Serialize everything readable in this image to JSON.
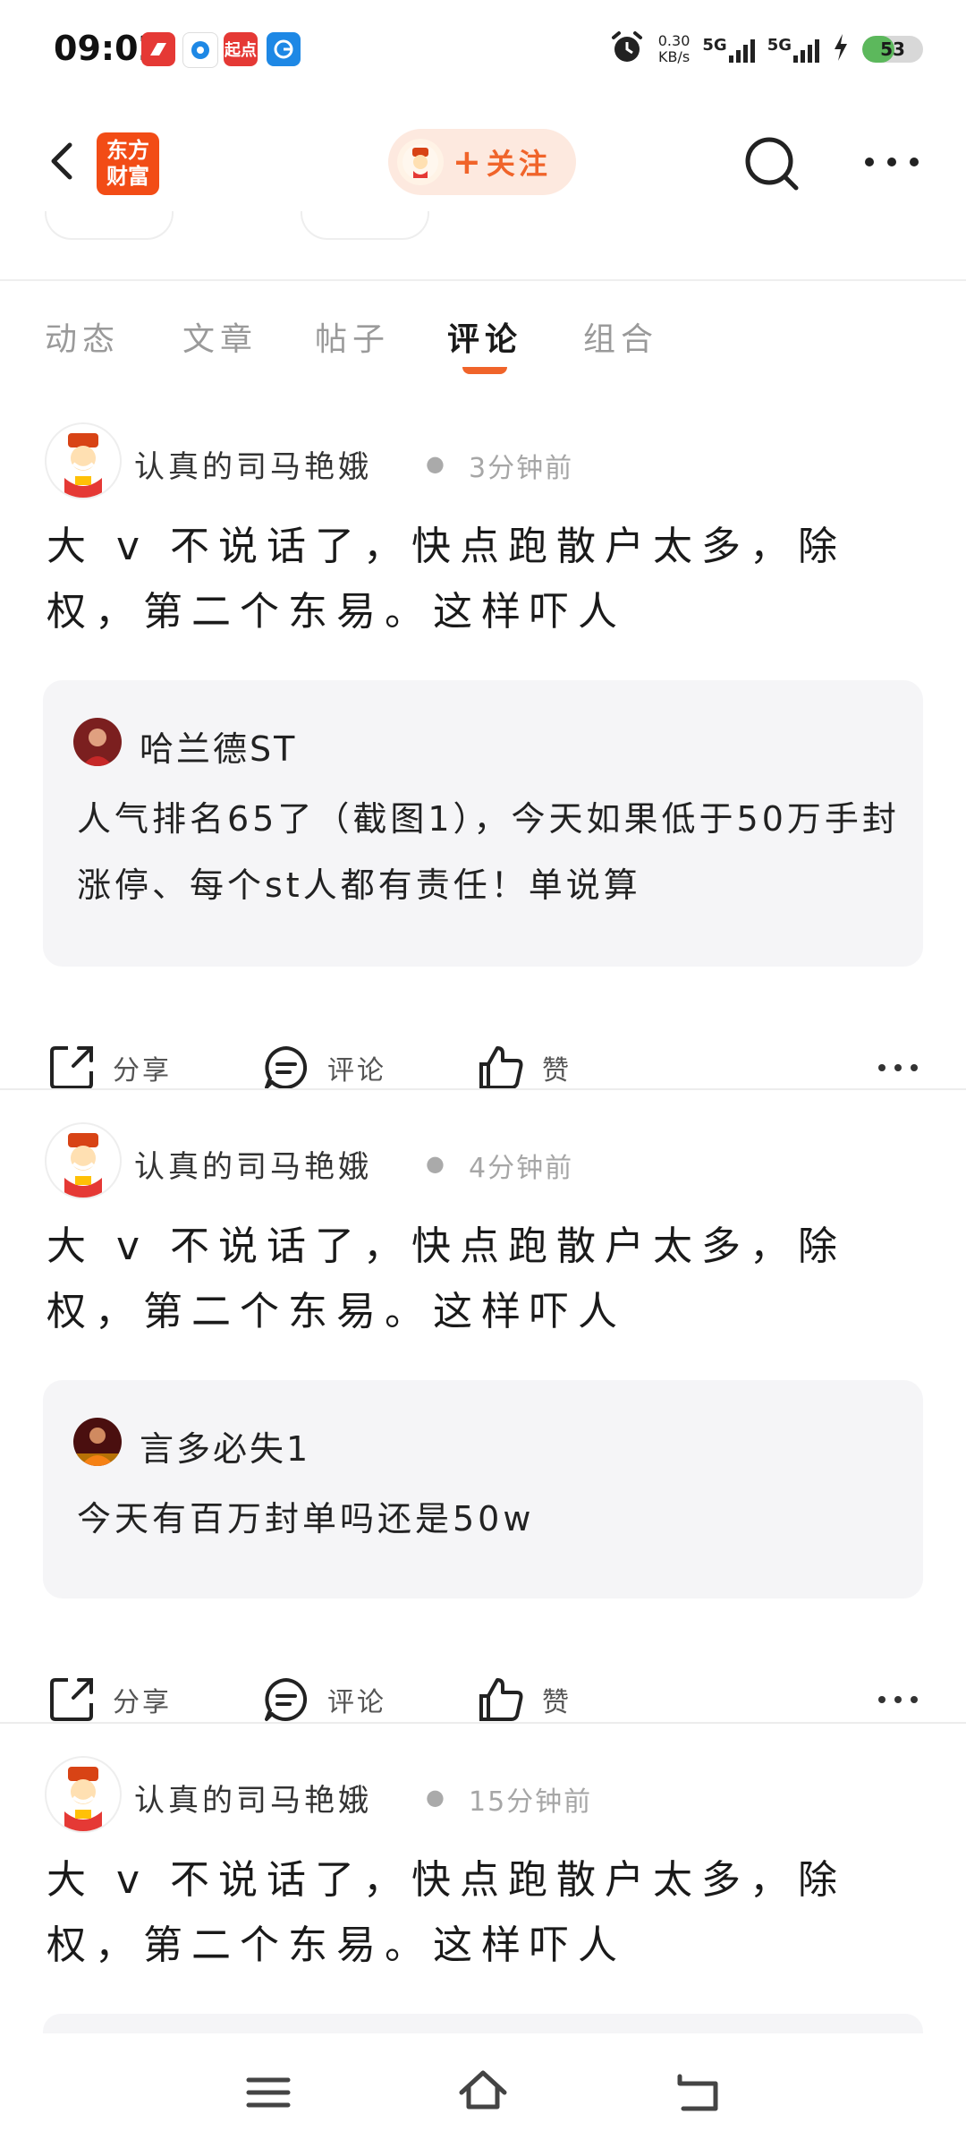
{
  "status_bar": {
    "time": "09:02",
    "app_icons": [
      {
        "name": "red-app-icon",
        "color": "#e53935",
        "text": ""
      },
      {
        "name": "blue-app-icon",
        "color": "#1e88e5",
        "text": ""
      },
      {
        "name": "qidian-app-icon",
        "color": "#e53935",
        "text": "起点"
      },
      {
        "name": "gf-app-icon",
        "color": "#1e88e5",
        "text": ""
      }
    ],
    "net_speed_value": "0.30",
    "net_speed_unit": "KB/s",
    "network_1": "5G",
    "network_2": "5G",
    "battery": "53",
    "battery_level": 0.53
  },
  "header": {
    "logo_line1": "东方",
    "logo_line2": "财富",
    "follow_plus": "+",
    "follow_label": "关注",
    "brand_color": "#f24c16",
    "accent_color": "#f0642a"
  },
  "tabs": [
    {
      "label": "动态",
      "active": false
    },
    {
      "label": "文章",
      "active": false
    },
    {
      "label": "帖子",
      "active": false
    },
    {
      "label": "评论",
      "active": true
    },
    {
      "label": "组合",
      "active": false
    }
  ],
  "posts": [
    {
      "author": "认真的司马艳娥",
      "time": "3分钟前",
      "content": "大 v 不说话了，快点跑散户太多，除权，第二个东易。这样吓人",
      "quote": {
        "author": "哈兰德ST",
        "text": "人气排名65了（截图1），今天如果低于50万手封涨停、每个st人都有责任！单说算"
      },
      "actions": {
        "share": "分享",
        "comment": "评论",
        "like": "赞"
      }
    },
    {
      "author": "认真的司马艳娥",
      "time": "4分钟前",
      "content": "大 v 不说话了，快点跑散户太多，除权，第二个东易。这样吓人",
      "quote": {
        "author": "言多必失1",
        "text": "今天有百万封单吗还是50w"
      },
      "actions": {
        "share": "分享",
        "comment": "评论",
        "like": "赞"
      }
    },
    {
      "author": "认真的司马艳娥",
      "time": "15分钟前",
      "content": "大 v 不说话了，快点跑散户太多，除权，第二个东易。这样吓人"
    }
  ]
}
